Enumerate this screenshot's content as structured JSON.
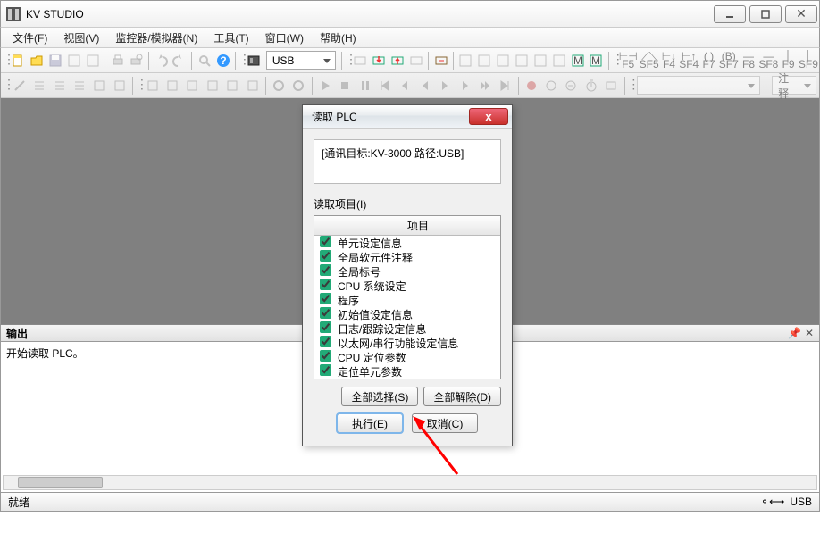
{
  "title": "KV STUDIO",
  "menu": [
    "文件(F)",
    "视图(V)",
    "监控器/模拟器(N)",
    "工具(T)",
    "窗口(W)",
    "帮助(H)"
  ],
  "combo_conn": "USB",
  "combo_note_label": "注释",
  "flabels": [
    "F5",
    "SF5",
    "F4",
    "SF4",
    "F7",
    "SF7",
    "F8",
    "SF8",
    "F9",
    "SF9"
  ],
  "output": {
    "title": "输出",
    "text": "开始读取 PLC。"
  },
  "status": {
    "left": "就绪",
    "right": "USB"
  },
  "dialog": {
    "title": "读取 PLC",
    "info": "[通讯目标:KV-3000 路径:USB]",
    "section": "读取项目(I)",
    "col": "项目",
    "items": [
      "单元设定信息",
      "全局软元件注释",
      "全局标号",
      "CPU 系统设定",
      "程序",
      "初始值设定信息",
      "日志/跟踪设定信息",
      "以太网/串行功能设定信息",
      "CPU 定位参数",
      "定位单元参数"
    ],
    "btn_selall": "全部选择(S)",
    "btn_clrall": "全部解除(D)",
    "btn_exec": "执行(E)",
    "btn_cancel": "取消(C)"
  }
}
